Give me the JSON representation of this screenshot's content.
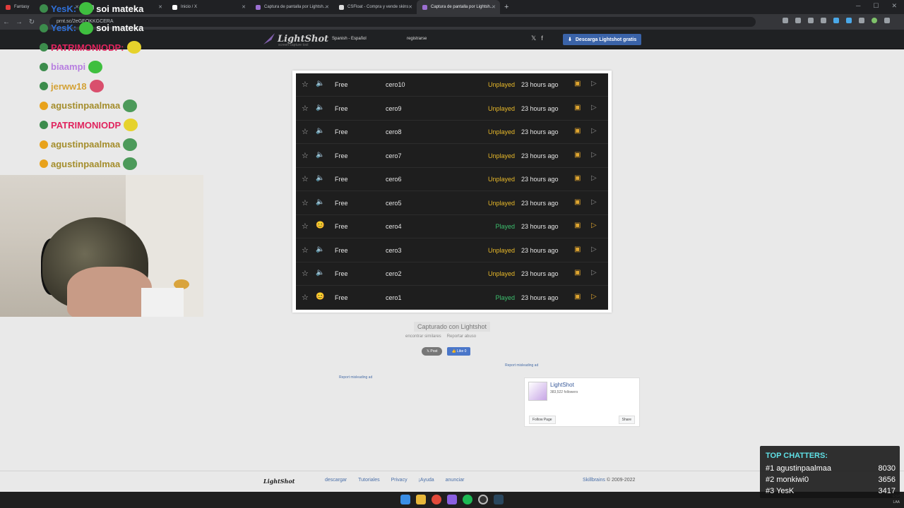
{
  "browser": {
    "tabs": [
      {
        "label": "Fantasy",
        "color": "#e03c3c"
      },
      {
        "label": "",
        "color": "#9aa0a6"
      },
      {
        "label": "Inicio / X",
        "color": "#ffffff"
      },
      {
        "label": "Captura de pantalla por Lightsh...",
        "color": "#9b6fd1"
      },
      {
        "label": "CSFloat - Compra y vende skins",
        "color": "#dddddd"
      },
      {
        "label": "Captura de pantalla por Lightsh...",
        "color": "#9b6fd1"
      }
    ],
    "new_tab": "+",
    "url": "prnt.sc/2eGEOKKGCERA"
  },
  "lightshot_header": {
    "logo": "LightShot",
    "tagline": "screen capture tool",
    "language": "Spanish - Español",
    "register": "registrarse",
    "download_button": "Descarga Lightshot gratis",
    "twitter": "𝕏",
    "facebook": "f"
  },
  "screenshot_list": {
    "rows": [
      {
        "price": "Free",
        "name": "cero10",
        "status": "Unplayed",
        "time": "23 hours ago",
        "played": false
      },
      {
        "price": "Free",
        "name": "cero9",
        "status": "Unplayed",
        "time": "23 hours ago",
        "played": false
      },
      {
        "price": "Free",
        "name": "cero8",
        "status": "Unplayed",
        "time": "23 hours ago",
        "played": false
      },
      {
        "price": "Free",
        "name": "cero7",
        "status": "Unplayed",
        "time": "23 hours ago",
        "played": false
      },
      {
        "price": "Free",
        "name": "cero6",
        "status": "Unplayed",
        "time": "23 hours ago",
        "played": false
      },
      {
        "price": "Free",
        "name": "cero5",
        "status": "Unplayed",
        "time": "23 hours ago",
        "played": false
      },
      {
        "price": "Free",
        "name": "cero4",
        "status": "Played",
        "time": "23 hours ago",
        "played": true
      },
      {
        "price": "Free",
        "name": "cero3",
        "status": "Unplayed",
        "time": "23 hours ago",
        "played": false
      },
      {
        "price": "Free",
        "name": "cero2",
        "status": "Unplayed",
        "time": "23 hours ago",
        "played": false
      },
      {
        "price": "Free",
        "name": "cero1",
        "status": "Played",
        "time": "23 hours ago",
        "played": true
      }
    ],
    "colors": {
      "unplayed": "#e8b92a",
      "played": "#3dbf6e"
    }
  },
  "page": {
    "caption": "Capturado con Lightshot",
    "find_similar": "encontrar similares",
    "report_abuse": "Reportar abuso",
    "post_button": "𝕏 Post",
    "like_button": "👍 Like 0",
    "report_ad_1": "Report misleading ad",
    "report_ad_2": "Report misleading ad"
  },
  "fb_widget": {
    "name": "LightShot",
    "followers": "383,522 followers",
    "follow": "Follow Page",
    "share": "Share"
  },
  "footer": {
    "logo": "LightShot",
    "links": [
      "descargar",
      "Tutoriales",
      "Privacy",
      "¡Ayuda",
      "anunciar"
    ],
    "company": "Skillbrains",
    "copyright": "© 2009-2022"
  },
  "stream_chat": {
    "messages": [
      {
        "user": "YesK:",
        "text": "soi mateka",
        "user_color": "#2f6fd6"
      },
      {
        "user": "YesK:",
        "text": "soi mateka",
        "user_color": "#2f6fd6"
      },
      {
        "user": "PATRIMONIODP:",
        "text": "",
        "user_color": "#e0245e"
      },
      {
        "user": "biaampi",
        "text": "",
        "user_color": "#b77ee0"
      },
      {
        "user": "jerww18",
        "text": "",
        "user_color": "#d4a236"
      },
      {
        "user": "agustinpaalmaa",
        "text": "",
        "user_color": "#a48d2c"
      },
      {
        "user": "PATRIMONIODP",
        "text": "",
        "user_color": "#e0245e"
      },
      {
        "user": "agustinpaalmaa",
        "text": "",
        "user_color": "#a48d2c"
      },
      {
        "user": "agustinpaalmaa",
        "text": "",
        "user_color": "#a48d2c"
      }
    ]
  },
  "top_chatters": {
    "title": "TOP CHATTERS:",
    "entries": [
      {
        "rank": "#1",
        "name": "agustinpaalmaa",
        "count": "8030"
      },
      {
        "rank": "#2",
        "name": "monkiwi0",
        "count": "3656"
      },
      {
        "rank": "#3",
        "name": "YesK",
        "count": "3417"
      }
    ]
  },
  "taskbar": {
    "lang": "ESP",
    "region": "LAA"
  }
}
